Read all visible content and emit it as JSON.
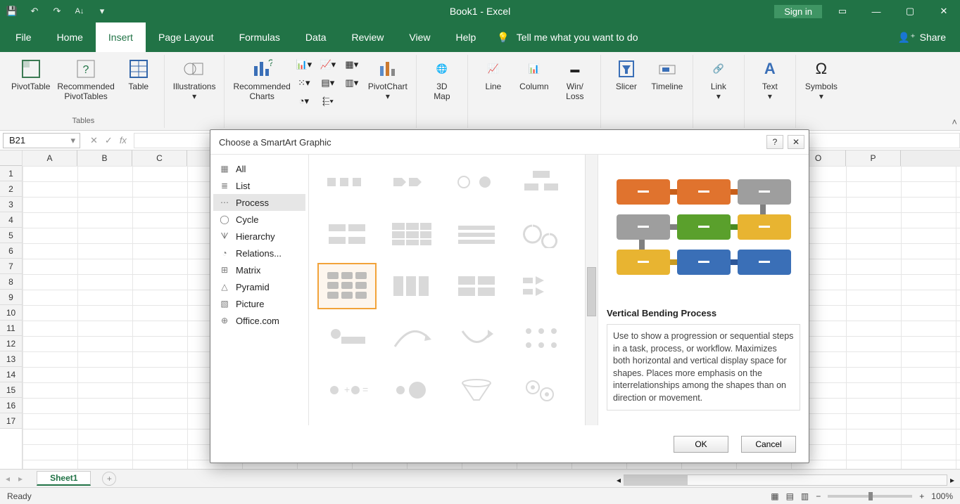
{
  "app": {
    "title": "Book1  -  Excel"
  },
  "titlebar": {
    "signin": "Sign in"
  },
  "tabs": {
    "items": [
      "File",
      "Home",
      "Insert",
      "Page Layout",
      "Formulas",
      "Data",
      "Review",
      "View",
      "Help"
    ],
    "active": "Insert",
    "tellme": "Tell me what you want to do",
    "share": "Share"
  },
  "ribbon": {
    "groups": {
      "tables": {
        "label": "Tables",
        "pivot": "PivotTable",
        "recommended": "Recommended\nPivotTables",
        "table": "Table"
      },
      "illustrations": {
        "label": "Illustrations"
      },
      "charts": {
        "recommended": "Recommended\nCharts",
        "pivotchart": "PivotChart"
      },
      "tours": {
        "map": "3D\nMap"
      },
      "sparklines": {
        "line": "Line",
        "column": "Column",
        "winloss": "Win/\nLoss"
      },
      "filters": {
        "slicer": "Slicer",
        "timeline": "Timeline"
      },
      "links": {
        "link": "Link"
      },
      "text": {
        "label": "Text"
      },
      "symbols": {
        "label": "Symbols"
      }
    }
  },
  "fxbar": {
    "cell": "B21"
  },
  "grid": {
    "cols": [
      "A",
      "B",
      "C",
      "",
      "",
      "",
      "",
      "",
      "",
      "",
      "",
      "",
      "",
      "",
      "O",
      "P"
    ],
    "rows": 17
  },
  "sheets": {
    "active": "Sheet1"
  },
  "status": {
    "text": "Ready",
    "zoom": "100%"
  },
  "dialog": {
    "title": "Choose a SmartArt Graphic",
    "categories": [
      "All",
      "List",
      "Process",
      "Cycle",
      "Hierarchy",
      "Relations...",
      "Matrix",
      "Pyramid",
      "Picture",
      "Office.com"
    ],
    "active_category": "Process",
    "preview": {
      "title": "Vertical Bending Process",
      "desc": "Use to show a progression or sequential steps in a task, process, or workflow. Maximizes both horizontal and vertical display space for shapes. Places more emphasis on the interrelationships among the shapes than on direction or movement."
    },
    "buttons": {
      "ok": "OK",
      "cancel": "Cancel"
    }
  }
}
